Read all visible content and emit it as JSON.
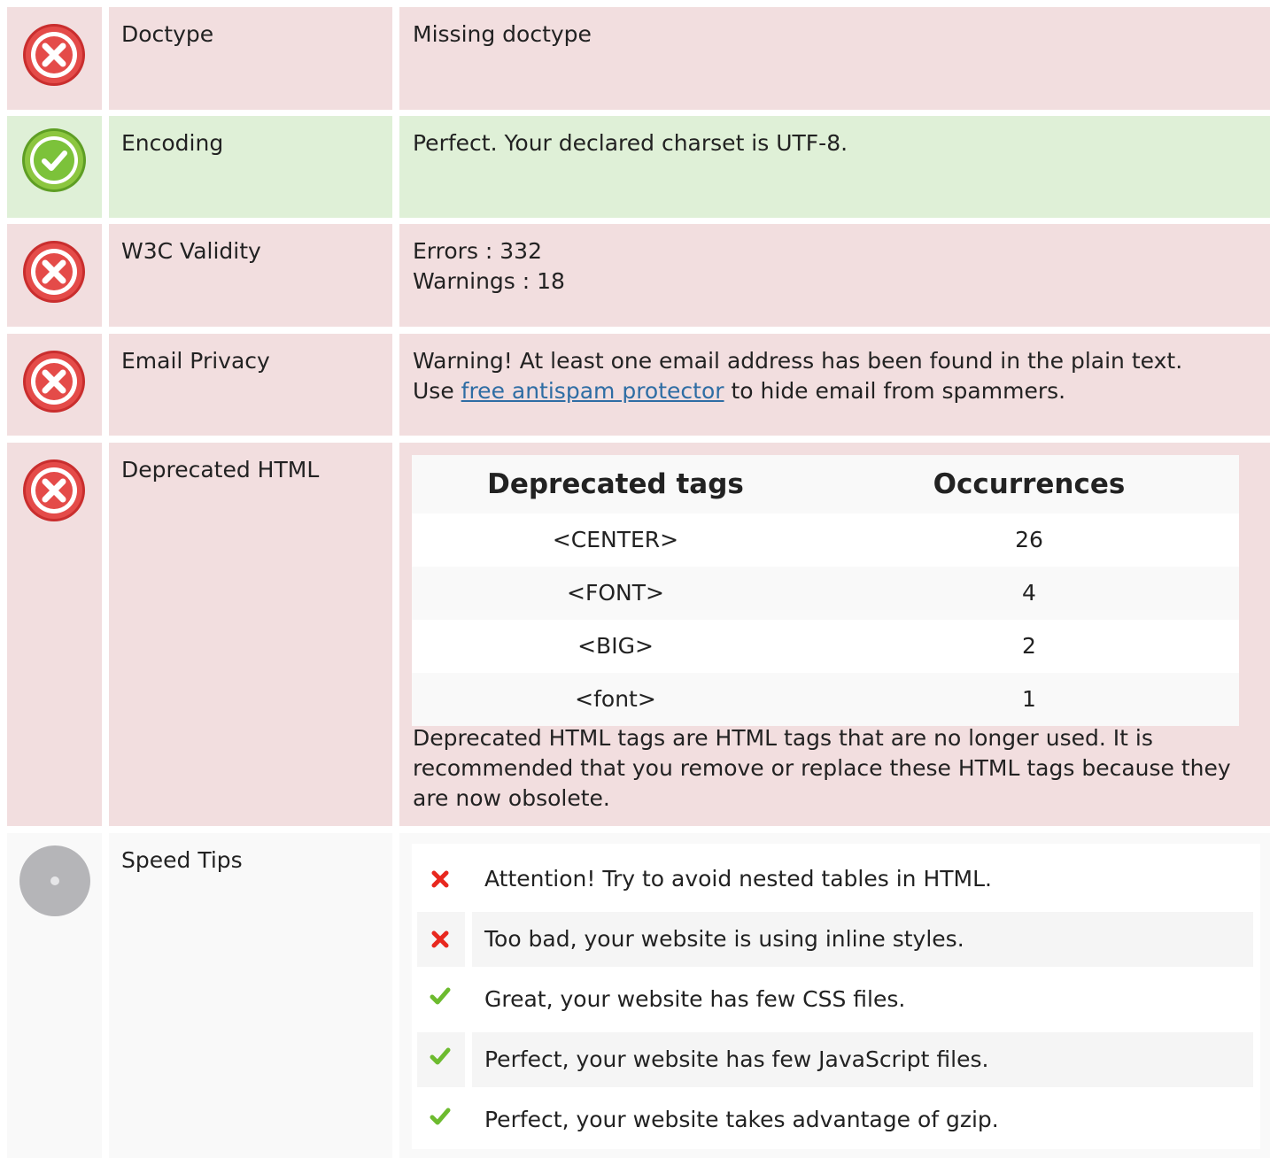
{
  "rows": {
    "doctype": {
      "status": "error",
      "label": "Doctype",
      "value": "Missing doctype"
    },
    "encoding": {
      "status": "success",
      "label": "Encoding",
      "value": "Perfect. Your declared charset is UTF-8."
    },
    "w3c": {
      "status": "error",
      "label": "W3C Validity",
      "errors": "Errors : 332",
      "warnings": "Warnings : 18"
    },
    "email": {
      "status": "error",
      "label": "Email Privacy",
      "line1": "Warning! At least one email address has been found in the plain text.",
      "line2_prefix": "Use ",
      "link_text": "free antispam protector",
      "line2_suffix": " to hide email from spammers."
    },
    "deprecated": {
      "status": "error",
      "label": "Deprecated HTML",
      "table": {
        "headers": [
          "Deprecated tags",
          "Occurrences"
        ],
        "rows": [
          {
            "tag": "<CENTER>",
            "count": "26"
          },
          {
            "tag": "<FONT>",
            "count": "4"
          },
          {
            "tag": "<BIG>",
            "count": "2"
          },
          {
            "tag": "<font>",
            "count": "1"
          }
        ]
      },
      "note": "Deprecated HTML tags are HTML tags that are no longer used. It is recommended that you remove or replace these HTML tags because they are now obsolete."
    },
    "speed": {
      "status": "neutral",
      "label": "Speed Tips",
      "tips": [
        {
          "status": "fail",
          "icon": "red-x-icon",
          "text": "Attention! Try to avoid nested tables in HTML."
        },
        {
          "status": "fail",
          "icon": "red-x-icon",
          "text": "Too bad, your website is using inline styles."
        },
        {
          "status": "pass",
          "icon": "green-check-icon",
          "text": "Great, your website has few CSS files."
        },
        {
          "status": "pass",
          "icon": "green-check-icon",
          "text": "Perfect, your website has few JavaScript files."
        },
        {
          "status": "pass",
          "icon": "green-check-icon",
          "text": "Perfect, your website takes advantage of gzip."
        }
      ]
    }
  },
  "colors": {
    "error_bg": "#f2dedf",
    "success_bg": "#dff0d7",
    "neutral_bg": "#f9f9f9",
    "error_icon": "#e0403f",
    "success_icon": "#7cc23a",
    "neutral_icon": "#b5b5b8",
    "link": "#2e6da4"
  }
}
